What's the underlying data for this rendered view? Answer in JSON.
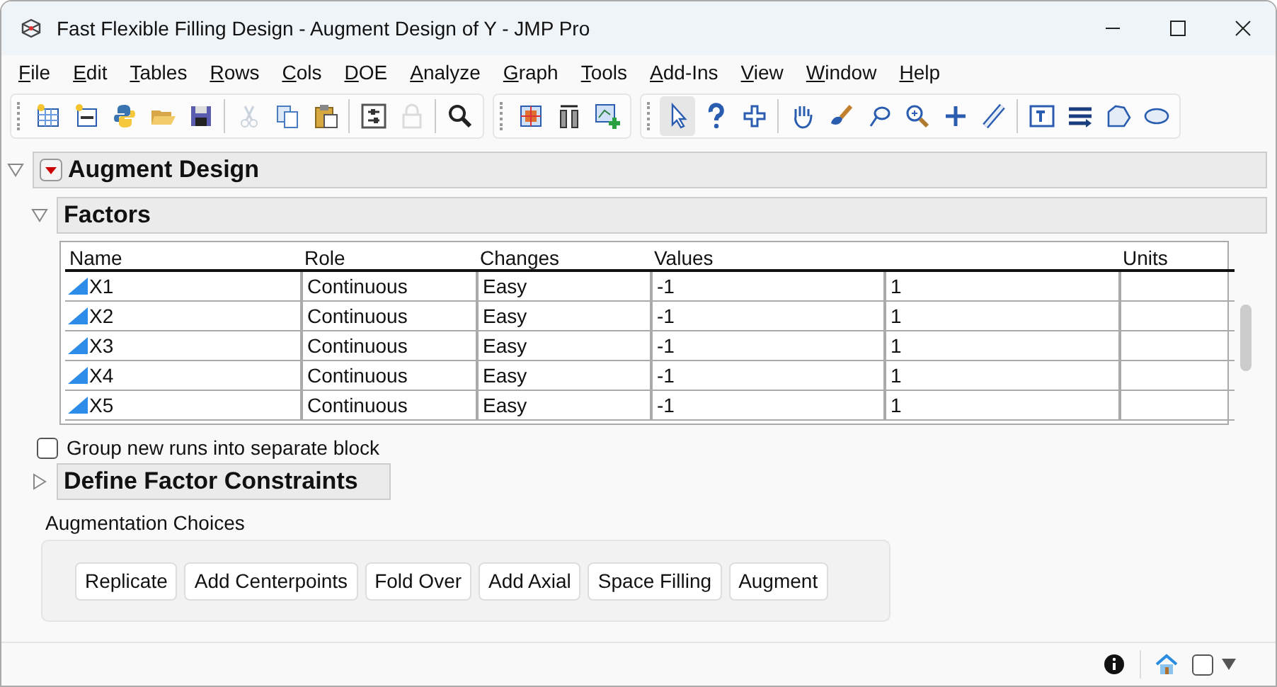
{
  "window": {
    "title": "Fast Flexible Filling Design - Augment Design of Y - JMP Pro"
  },
  "menu": [
    "File",
    "Edit",
    "Tables",
    "Rows",
    "Cols",
    "DOE",
    "Analyze",
    "Graph",
    "Tools",
    "Add-Ins",
    "View",
    "Window",
    "Help"
  ],
  "toolbars": [
    {
      "sections": [
        [
          {
            "kind": "new-table",
            "selected": false,
            "disabled": false
          },
          {
            "kind": "new-script",
            "selected": false,
            "disabled": false
          },
          {
            "kind": "python",
            "selected": false,
            "disabled": false
          },
          {
            "kind": "open",
            "selected": false,
            "disabled": false
          },
          {
            "kind": "save",
            "selected": false,
            "disabled": false
          }
        ],
        [
          {
            "kind": "cut",
            "selected": false,
            "disabled": true
          },
          {
            "kind": "copy",
            "selected": false,
            "disabled": false
          },
          {
            "kind": "paste",
            "selected": false,
            "disabled": false
          }
        ],
        [
          {
            "kind": "settings",
            "selected": false,
            "disabled": false
          },
          {
            "kind": "lock",
            "selected": false,
            "disabled": true
          }
        ],
        [
          {
            "kind": "search",
            "selected": false,
            "disabled": false
          }
        ]
      ]
    },
    {
      "sections": [
        [
          {
            "kind": "grid",
            "selected": false,
            "disabled": false
          },
          {
            "kind": "columns",
            "selected": false,
            "disabled": false
          },
          {
            "kind": "add-graph",
            "selected": false,
            "disabled": false
          }
        ]
      ]
    },
    {
      "sections": [
        [
          {
            "kind": "arrow",
            "selected": true,
            "disabled": false
          },
          {
            "kind": "help",
            "selected": false,
            "disabled": false
          },
          {
            "kind": "crosshair",
            "selected": false,
            "disabled": false
          }
        ],
        [
          {
            "kind": "hand",
            "selected": false,
            "disabled": false
          },
          {
            "kind": "brush",
            "selected": false,
            "disabled": false
          },
          {
            "kind": "lasso",
            "selected": false,
            "disabled": false
          },
          {
            "kind": "zoom",
            "selected": false,
            "disabled": false
          },
          {
            "kind": "plus",
            "selected": false,
            "disabled": false
          },
          {
            "kind": "ruler",
            "selected": false,
            "disabled": false
          }
        ],
        [
          {
            "kind": "text",
            "selected": false,
            "disabled": false
          },
          {
            "kind": "lines",
            "selected": false,
            "disabled": false
          },
          {
            "kind": "polygon",
            "selected": false,
            "disabled": false
          },
          {
            "kind": "ellipse",
            "selected": false,
            "disabled": false
          }
        ]
      ]
    }
  ],
  "report": {
    "title": "Augment Design",
    "expanded": true,
    "factors": {
      "title": "Factors",
      "expanded": true,
      "columns": [
        "Name",
        "Role",
        "Changes",
        "Values",
        "Units"
      ],
      "rows": [
        {
          "name": "X1",
          "role": "Continuous",
          "changes": "Easy",
          "values": [
            "-1",
            "1"
          ]
        },
        {
          "name": "X2",
          "role": "Continuous",
          "changes": "Easy",
          "values": [
            "-1",
            "1"
          ]
        },
        {
          "name": "X3",
          "role": "Continuous",
          "changes": "Easy",
          "values": [
            "-1",
            "1"
          ]
        },
        {
          "name": "X4",
          "role": "Continuous",
          "changes": "Easy",
          "values": [
            "-1",
            "1"
          ]
        },
        {
          "name": "X5",
          "role": "Continuous",
          "changes": "Easy",
          "values": [
            "-1",
            "1"
          ]
        }
      ]
    },
    "group_option": {
      "label": "Group new runs into separate block",
      "checked": false
    },
    "constraints": {
      "title": "Define Factor Constraints",
      "expanded": false
    },
    "augmentation": {
      "title": "Augmentation Choices",
      "buttons": [
        "Replicate",
        "Add Centerpoints",
        "Fold Over",
        "Add Axial",
        "Space Filling",
        "Augment"
      ]
    }
  },
  "status_bar": {
    "checkbox": {
      "checked": false
    }
  }
}
